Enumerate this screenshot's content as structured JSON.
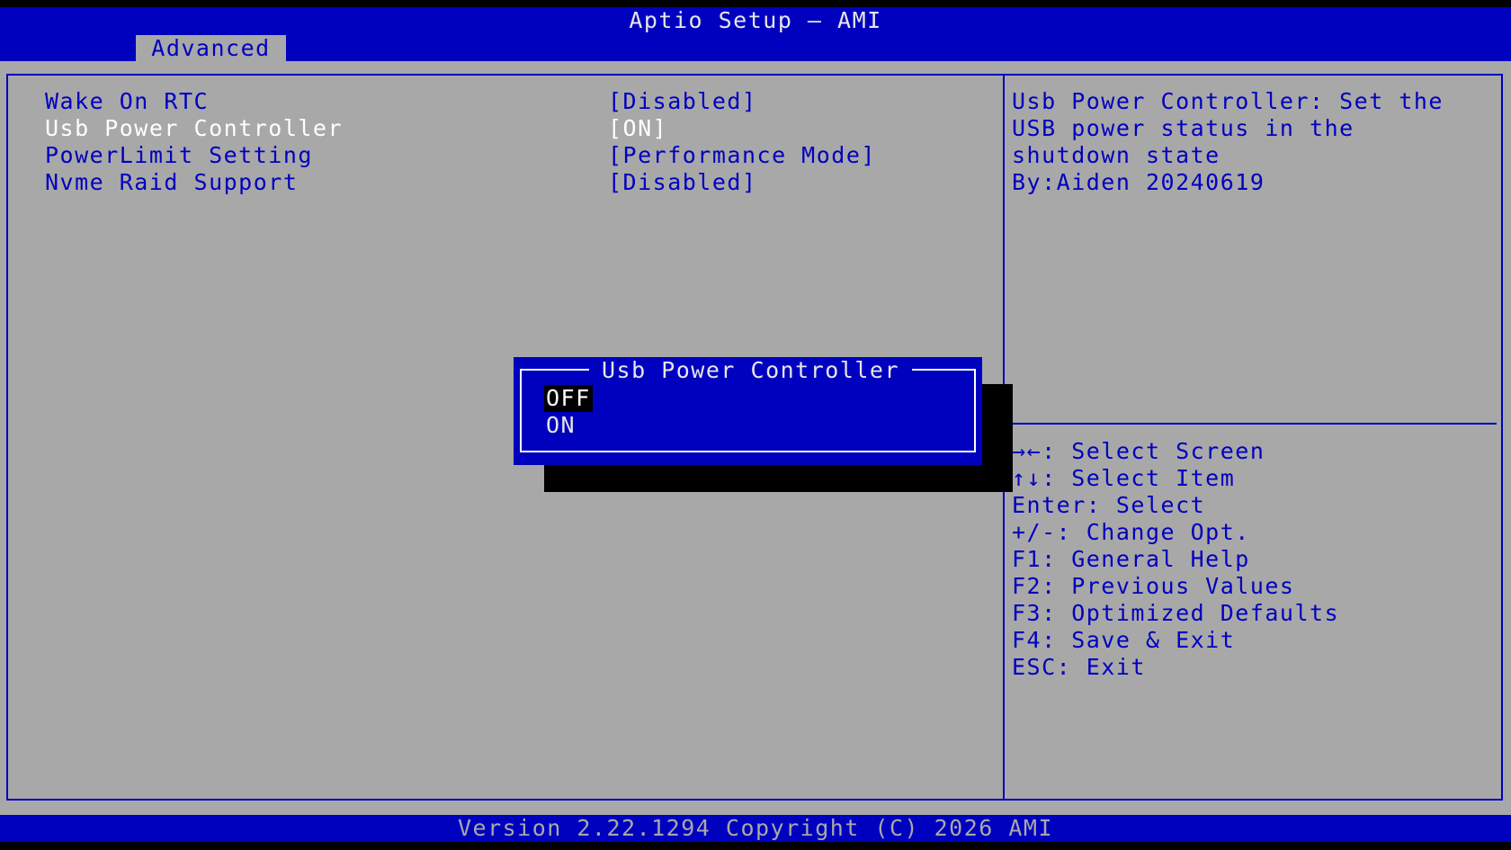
{
  "window": {
    "title": "Aptio Setup – AMI"
  },
  "tabs": [
    {
      "label": "Advanced"
    }
  ],
  "settings": [
    {
      "label": "Wake On RTC",
      "value": "[Disabled]"
    },
    {
      "label": "Usb Power Controller",
      "value": "[ON]"
    },
    {
      "label": "PowerLimit Setting",
      "value": "[Performance Mode]"
    },
    {
      "label": "Nvme Raid Support",
      "value": "[Disabled]"
    }
  ],
  "help": {
    "lines": [
      "Usb Power Controller: Set the",
      "USB power status in the",
      "shutdown state",
      "By:Aiden 20240619"
    ]
  },
  "keys": [
    "→←: Select Screen",
    "↑↓: Select Item",
    "Enter: Select",
    "+/-: Change Opt.",
    "F1: General Help",
    "F2: Previous Values",
    "F3: Optimized Defaults",
    "F4: Save & Exit",
    "ESC: Exit"
  ],
  "popup": {
    "title": "Usb Power Controller",
    "options": [
      "OFF",
      "ON"
    ],
    "selected": "OFF"
  },
  "footer": {
    "text": "Version 2.22.1294 Copyright (C) 2026 AMI"
  },
  "colors": {
    "bios_blue": "#0000BF",
    "panel_gray": "#A8A8A8",
    "text_white": "#FFFFFF",
    "shadow_black": "#000000"
  }
}
